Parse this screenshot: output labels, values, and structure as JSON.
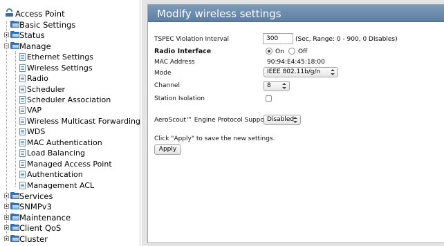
{
  "tree": {
    "root": "Access Point",
    "basic_settings": "Basic Settings",
    "status": "Status",
    "manage": "Manage",
    "manage_items": [
      "Ethernet Settings",
      "Wireless Settings",
      "Radio",
      "Scheduler",
      "Scheduler Association",
      "VAP",
      "Wireless Multicast Forwarding",
      "WDS",
      "MAC Authentication",
      "Load Balancing",
      "Managed Access Point",
      "Authentication",
      "Management ACL"
    ],
    "bottom_items": [
      "Services",
      "SNMPv3",
      "Maintenance",
      "Client QoS",
      "Cluster"
    ]
  },
  "panel": {
    "title": "Modify wireless settings",
    "tspec_label": "TSPEC Violation Interval",
    "tspec_value": "300",
    "tspec_hint": "(Sec, Range: 0 - 900, 0 Disables)",
    "radio_interface_label": "Radio Interface",
    "radio_on_label": "On",
    "radio_off_label": "Off",
    "radio_selected": "On",
    "mac_label": "MAC Address",
    "mac_value": "90:94:E4:45:18:00",
    "mode_label": "Mode",
    "mode_value": "IEEE 802.11b/g/n",
    "channel_label": "Channel",
    "channel_value": "8",
    "station_isolation_label": "Station Isolation",
    "station_isolation_checked": false,
    "aeroscout_label": "AeroScout™ Engine Protocol Support",
    "aeroscout_value": "Disabled",
    "apply_hint": "Click \"Apply\" to save the new settings.",
    "apply_button": "Apply"
  },
  "colors": {
    "header_bg": "#6a8aad",
    "panel_border": "#9aa7b6",
    "content_bg": "#e4e4e4"
  }
}
